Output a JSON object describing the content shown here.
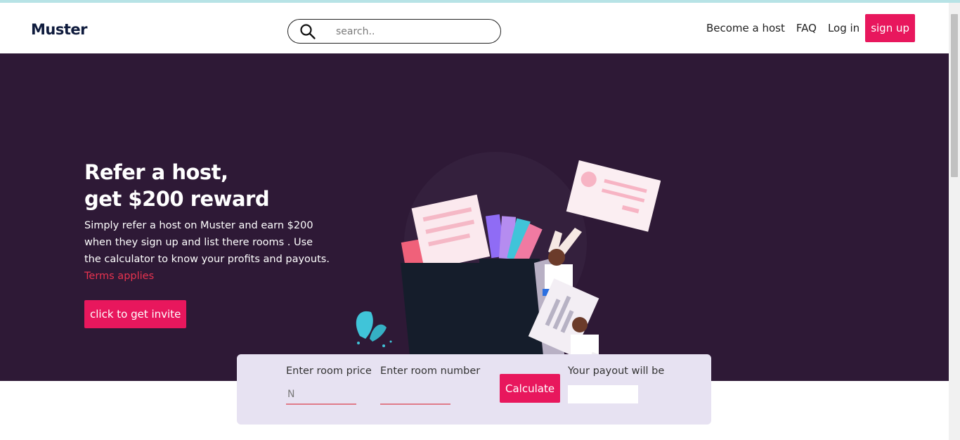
{
  "header": {
    "logo": "Muster",
    "search_placeholder": "search..",
    "nav": {
      "become_host": "Become a host",
      "faq": "FAQ",
      "login": "Log in",
      "signup": "sign up"
    }
  },
  "hero": {
    "title_line1": "Refer a host,",
    "title_line2": "get $200 reward",
    "description": "Simply refer a host on Muster and earn $200 when they sign up and list there rooms . Use the calculator to know your profits and payouts.",
    "terms": "Terms applies",
    "invite_button": "click to get invite"
  },
  "calculator": {
    "room_price_label": "Enter room price",
    "room_price_placeholder": "N",
    "room_number_label": "Enter room number",
    "calculate_button": "Calculate",
    "payout_label": "Your payout will be"
  },
  "colors": {
    "accent": "#e8175d",
    "hero_bg": "#2e1936",
    "calc_bg": "#e7e2f2"
  }
}
